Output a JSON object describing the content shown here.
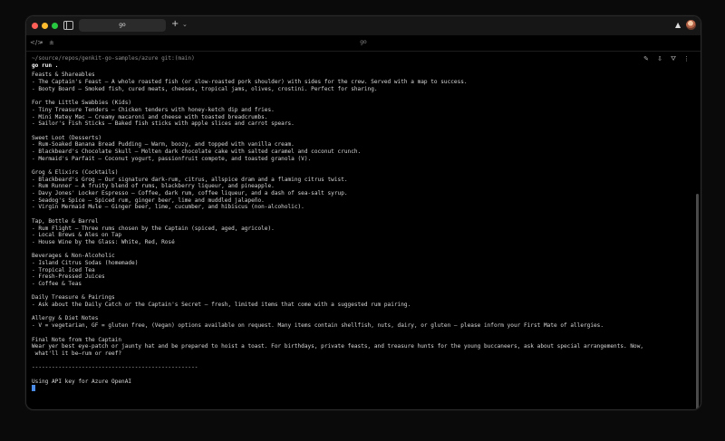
{
  "window": {
    "tab_title": "go",
    "center_title": "go",
    "new_tab_symbol": "+",
    "tab_menu_symbol": "⌄",
    "app_logo_symbol": "▲"
  },
  "toolbar": {
    "icons": [
      "code-icon",
      "search-icon",
      "plus-minus-icon"
    ],
    "actions": [
      "pin-icon",
      "download-icon",
      "filter-icon",
      "more-vertical-icon"
    ]
  },
  "terminal": {
    "path": "~/source/repos/genkit-go-samples/azure git:(main)",
    "command": "go run .",
    "lines": [
      "Feasts & Shareables",
      "- The Captain's Feast — A whole roasted fish (or slow-roasted pork shoulder) with sides for the crew. Served with a map to success.",
      "- Booty Board — Smoked fish, cured meats, cheeses, tropical jams, olives, crostini. Perfect for sharing.",
      "",
      "For the Little Swabbies (Kids)",
      "- Tiny Treasure Tenders — Chicken tenders with honey-ketch dip and fries.",
      "- Mini Matey Mac — Creamy macaroni and cheese with toasted breadcrumbs.",
      "- Sailor's Fish Sticks — Baked fish sticks with apple slices and carrot spears.",
      "",
      "Sweet Loot (Desserts)",
      "- Rum-Soaked Banana Bread Pudding — Warm, boozy, and topped with vanilla cream.",
      "- Blackbeard's Chocolate Skull — Molten dark chocolate cake with salted caramel and coconut crunch.",
      "- Mermaid's Parfait — Coconut yogurt, passionfruit compote, and toasted granola (V).",
      "",
      "Grog & Elixirs (Cocktails)",
      "- Blackbeard's Grog — Our signature dark-rum, citrus, allspice dram and a flaming citrus twist.",
      "- Rum Runner — A fruity blend of rums, blackberry liqueur, and pineapple.",
      "- Davy Jones' Locker Espresso — Coffee, dark rum, coffee liqueur, and a dash of sea-salt syrup.",
      "- Seadog's Spice — Spiced rum, ginger beer, lime and muddled jalapeño.",
      "- Virgin Mermaid Mule — Ginger beer, lime, cucumber, and hibiscus (non-alcoholic).",
      "",
      "Tap, Bottle & Barrel",
      "- Rum Flight — Three rums chosen by the Captain (spiced, aged, agricole).",
      "- Local Brews & Ales on Tap",
      "- House Wine by the Glass: White, Red, Rosé",
      "",
      "Beverages & Non-Alcoholic",
      "- Island Citrus Sodas (homemade)",
      "- Tropical Iced Tea",
      "- Fresh-Pressed Juices",
      "- Coffee & Teas",
      "",
      "Daily Treasure & Pairings",
      "- Ask about the Daily Catch or the Captain's Secret — fresh, limited items that come with a suggested rum pairing.",
      "",
      "Allergy & Diet Notes",
      "- V = vegetarian, GF = gluten free, (Vegan) options available on request. Many items contain shellfish, nuts, dairy, or gluten — please inform your First Mate of allergies.",
      "",
      "Final Note from the Captain",
      "Wear yer best eye-patch or jaunty hat and be prepared to hoist a toast. For birthdays, private feasts, and treasure hunts for the young buccaneers, ask about special arrangements. Now,",
      " what'll it be—rum or reef?",
      "",
      "--------------------------------------------------",
      "",
      "Using API key for Azure OpenAI"
    ]
  }
}
